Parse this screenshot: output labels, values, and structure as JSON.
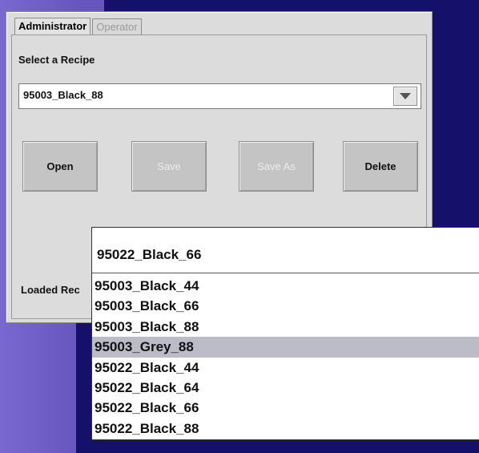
{
  "tabs": [
    {
      "label": "Administrator",
      "active": true
    },
    {
      "label": "Operator",
      "active": false
    }
  ],
  "select_recipe_label": "Select a Recipe",
  "recipe_combo": {
    "value": "95003_Black_88"
  },
  "buttons": {
    "open": "Open",
    "save": "Save",
    "save_as": "Save As",
    "delete": "Delete"
  },
  "loaded_recipe_label": "Loaded Rec",
  "popup": {
    "field_value": "95022_Black_66",
    "items": [
      "95003_Black_44",
      "95003_Black_66",
      "95003_Black_88",
      "95003_Grey_88",
      "95022_Black_44",
      "95022_Black_64",
      "95022_Black_66",
      "95022_Black_88"
    ],
    "selected_index": 3
  },
  "colors": {
    "background": "#6f5fc4",
    "navy": "#15106a",
    "panel": "#dcdcdc",
    "selection": "#bcbcc8"
  }
}
